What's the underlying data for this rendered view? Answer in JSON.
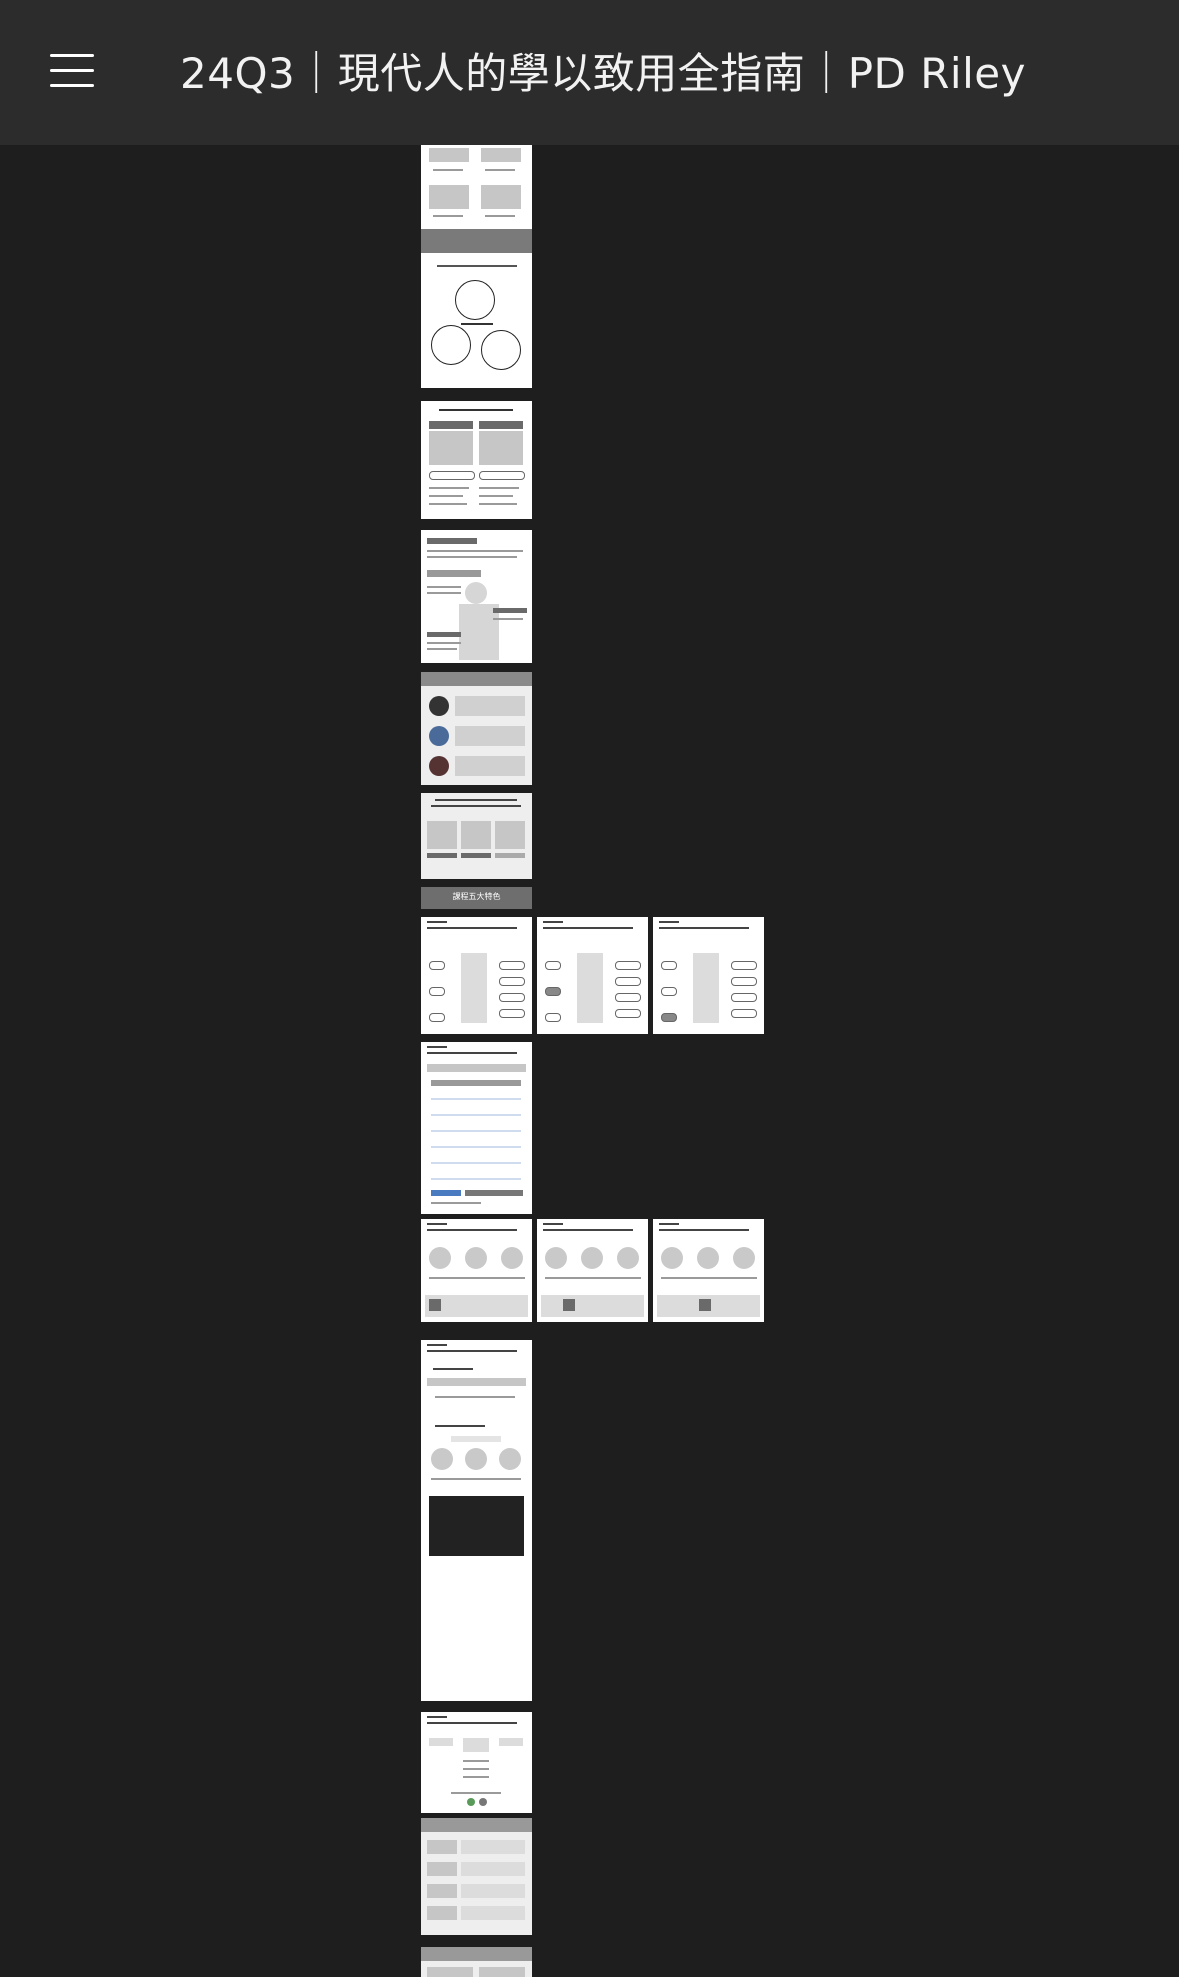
{
  "header": {
    "title": "24Q3｜現代人的學以致用全指南｜PD Riley",
    "menu_icon": "hamburger-menu-icon"
  },
  "canvas": {
    "features_label": "課程五大特色"
  },
  "colors": {
    "topbar": "#2c2c2c",
    "background": "#1e1e1e",
    "frame": "#ffffff",
    "placeholder": "#c6c6c6"
  }
}
